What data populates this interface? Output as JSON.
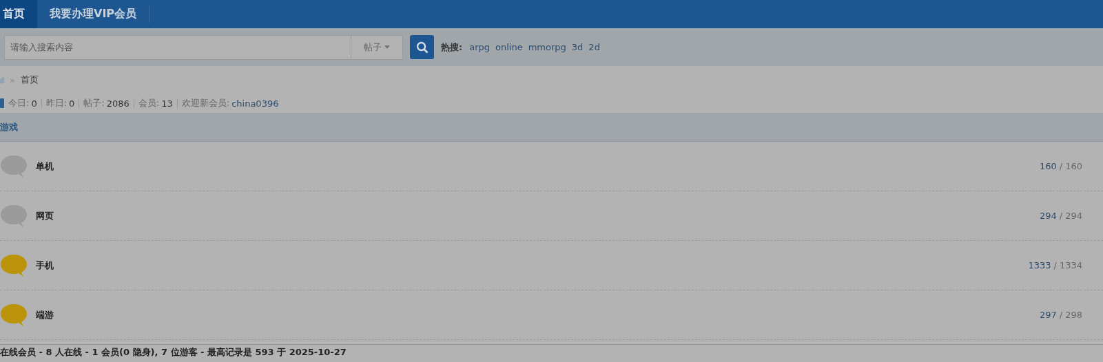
{
  "nav": [
    {
      "label": "首页",
      "selected": true
    },
    {
      "label": "我要办理VIP会员",
      "selected": false
    }
  ],
  "search": {
    "placeholder": "请输入搜索内容",
    "type_label": "帖子",
    "hot_label": "热搜:",
    "hot_terms": [
      "arpg",
      "online",
      "mmorpg",
      "3d",
      "2d"
    ]
  },
  "breadcrumb": {
    "separator": "»",
    "current": "首页"
  },
  "stats": [
    {
      "label": "今日:",
      "value": "0"
    },
    {
      "label": "昨日:",
      "value": "0"
    },
    {
      "label": "帖子:",
      "value": "2086"
    },
    {
      "label": "会员:",
      "value": "13"
    },
    {
      "label": "欢迎新会员:",
      "value": "china0396",
      "kind": "link"
    }
  ],
  "section": {
    "title": "游戏",
    "forums": [
      {
        "name": "单机",
        "new": false,
        "threads": "160",
        "slash": "/",
        "posts": "160"
      },
      {
        "name": "网页",
        "new": false,
        "threads": "294",
        "slash": "/",
        "posts": "294"
      },
      {
        "name": "手机",
        "new": true,
        "threads": "1333",
        "slash": "/",
        "posts": "1334"
      },
      {
        "name": "端游",
        "new": true,
        "threads": "297",
        "slash": "/",
        "posts": "298"
      }
    ]
  },
  "online": "在线会员 - 8 人在线 - 1 会员(0 隐身), 7 位游客 - 最高记录是 593 于 2025-10-27"
}
